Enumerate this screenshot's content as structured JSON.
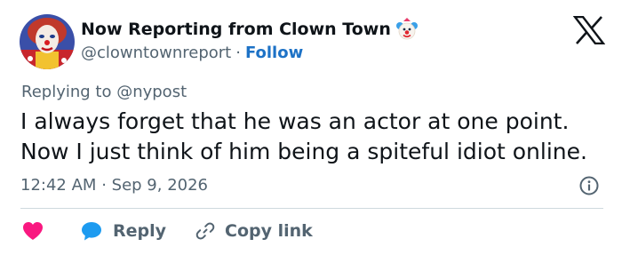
{
  "author": {
    "display_name": "Now Reporting from Clown Town",
    "handle": "@clowntownreport",
    "separator": "·",
    "follow_label": "Follow"
  },
  "reply_context": "Replying to @nypost",
  "tweet": {
    "lines": [
      "I always forget that he was an actor at one point.",
      "Now I just think of him being a spiteful idiot online."
    ],
    "time": "12:42 AM",
    "date_separator": "·",
    "date": "Sep 9, 2026"
  },
  "actions": {
    "reply_label": "Reply",
    "copy_link_label": "Copy link"
  },
  "icons": {
    "avatar": "clown-portrait-avatar",
    "badge": "clown-face-icon",
    "logo": "x-logo-icon",
    "info": "info-icon",
    "like": "heart-icon",
    "reply": "speech-bubble-icon",
    "copy": "link-icon"
  },
  "colors": {
    "text_primary": "#0f1419",
    "text_secondary": "#536471",
    "follow_blue": "#1d72c6",
    "heart_pink": "#f91880",
    "bubble_blue": "#1d9bf0",
    "divider": "#cfd9de"
  }
}
